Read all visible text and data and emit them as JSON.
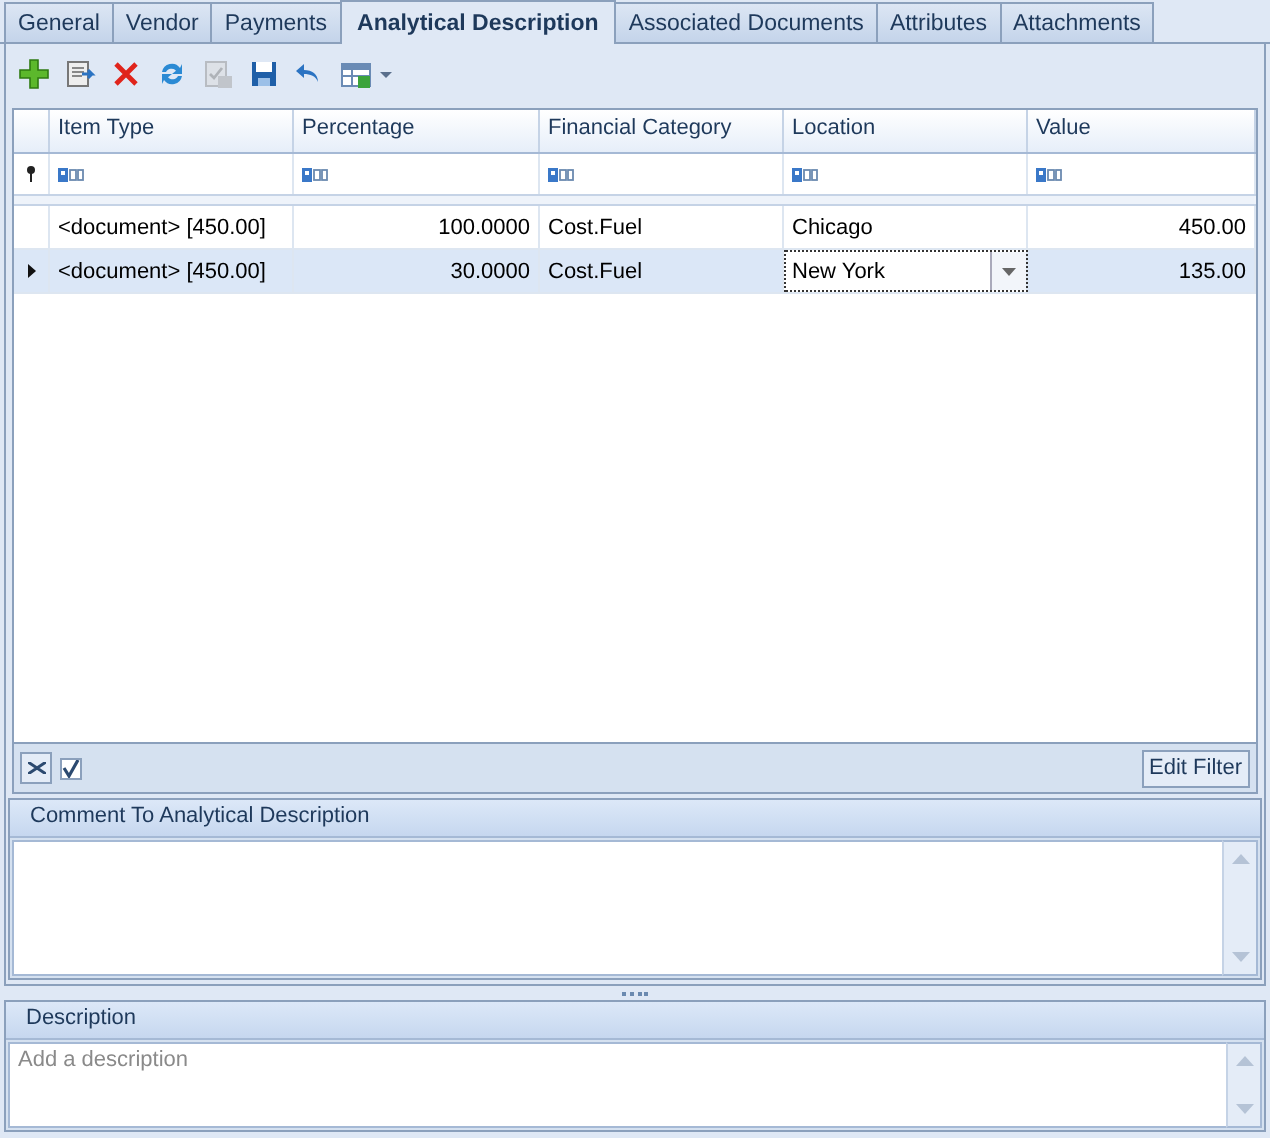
{
  "tabs": [
    {
      "label": "General",
      "selected": false
    },
    {
      "label": "Vendor",
      "selected": false
    },
    {
      "label": "Payments",
      "selected": false
    },
    {
      "label": "Analytical Description",
      "selected": true
    },
    {
      "label": "Associated Documents",
      "selected": false
    },
    {
      "label": "Attributes",
      "selected": false
    },
    {
      "label": "Attachments",
      "selected": false
    }
  ],
  "toolbar": [
    {
      "kind": "add",
      "disabled": false
    },
    {
      "kind": "edit",
      "disabled": false
    },
    {
      "kind": "delete",
      "disabled": false
    },
    {
      "kind": "refresh",
      "disabled": false
    },
    {
      "kind": "save-check",
      "disabled": true
    },
    {
      "kind": "save",
      "disabled": false
    },
    {
      "kind": "undo",
      "disabled": false
    },
    {
      "kind": "layout-menu",
      "disabled": false
    }
  ],
  "grid": {
    "columns": [
      {
        "label": "Item Type",
        "kind": "text"
      },
      {
        "label": "Percentage",
        "kind": "number"
      },
      {
        "label": "Financial Category",
        "kind": "text"
      },
      {
        "label": "Location",
        "kind": "text"
      },
      {
        "label": "Value",
        "kind": "number"
      }
    ],
    "rows": [
      {
        "selected": false,
        "cells": [
          {
            "text": "<document> [450.00]",
            "editing": false
          },
          {
            "text": "100.0000",
            "editing": false
          },
          {
            "text": "Cost.Fuel",
            "editing": false
          },
          {
            "text": "Chicago",
            "editing": false
          },
          {
            "text": "450.00",
            "editing": false
          }
        ]
      },
      {
        "selected": true,
        "cells": [
          {
            "text": "<document> [450.00]",
            "editing": false
          },
          {
            "text": "30.0000",
            "editing": false
          },
          {
            "text": "Cost.Fuel",
            "editing": false
          },
          {
            "text": "New York",
            "editing": true
          },
          {
            "text": "135.00",
            "editing": false
          }
        ]
      }
    ],
    "filter_enabled": {
      "checked": true
    },
    "edit_filter_button": "Edit Filter"
  },
  "comment_panel": {
    "title": "Comment To Analytical Description"
  },
  "description_panel": {
    "title": "Description",
    "placeholder": "Add a description"
  }
}
